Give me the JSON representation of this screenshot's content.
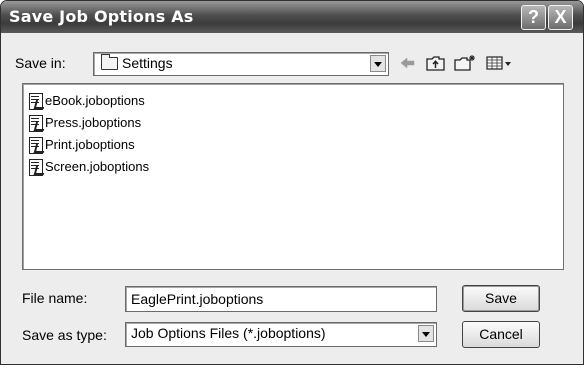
{
  "dialog": {
    "title": "Save Job Options As",
    "help_button": "?",
    "close_button": "X"
  },
  "save_in": {
    "label": "Save in:",
    "value": "Settings"
  },
  "toolbar": {
    "icons": [
      "back-arrow-icon",
      "up-one-level-icon",
      "new-folder-icon",
      "view-menu-icon"
    ]
  },
  "files": [
    {
      "name": "eBook.joboptions"
    },
    {
      "name": "Press.joboptions"
    },
    {
      "name": "Print.joboptions"
    },
    {
      "name": "Screen.joboptions"
    }
  ],
  "file_name": {
    "label": "File name:",
    "value": "EaglePrint.joboptions"
  },
  "save_as_type": {
    "label": "Save as type:",
    "value": "Job Options Files (*.joboptions)"
  },
  "buttons": {
    "save": "Save",
    "cancel": "Cancel"
  }
}
